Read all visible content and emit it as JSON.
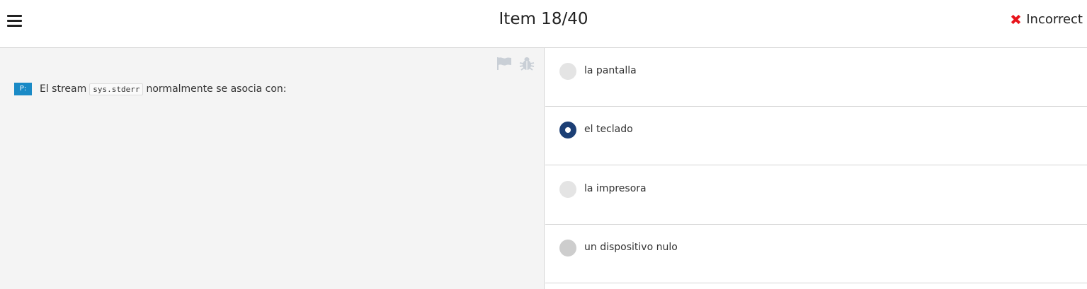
{
  "header": {
    "title": "Item 18/40",
    "status_label": "Incorrect",
    "status_icon": "x-icon",
    "status_color": "#e8141c"
  },
  "question": {
    "badge": "P:",
    "badge_color": "#1a8ac6",
    "text_before": "El stream",
    "code": "sys.stderr",
    "text_after": "normalmente se asocia con:",
    "tools": [
      "flag-icon",
      "bug-icon"
    ]
  },
  "options": [
    {
      "label": "la pantalla",
      "selected": false
    },
    {
      "label": "el teclado",
      "selected": true
    },
    {
      "label": "la impresora",
      "selected": false
    },
    {
      "label": "un dispositivo nulo",
      "selected": false
    }
  ],
  "colors": {
    "selected_radio": "#1c3f75",
    "radio": "#e4e4e4",
    "left_pane_bg": "#f4f4f4"
  }
}
